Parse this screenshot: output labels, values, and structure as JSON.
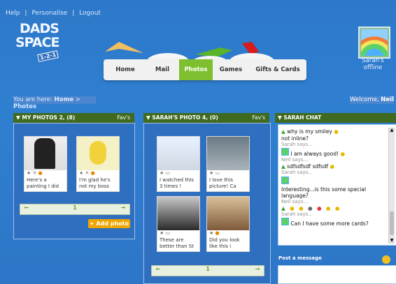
{
  "topbar": {
    "help": "Help",
    "sep1": "|",
    "personalise": "Personalise",
    "sep2": "|",
    "logout": "Logout"
  },
  "brand": {
    "line1": "DADS",
    "line2": "SPACE",
    "tag": "1-2-1"
  },
  "nav": {
    "tabs": [
      {
        "label": "Home"
      },
      {
        "label": "Mail"
      },
      {
        "label": "Photos"
      },
      {
        "label": "Games"
      },
      {
        "label": "Gifts & Cards"
      }
    ]
  },
  "profile": {
    "name": "Sarah's",
    "status": "offline"
  },
  "breadcrumb": {
    "prefix": "You are here:",
    "home": "Home",
    "sep": ">",
    "current": "Photos"
  },
  "welcome": {
    "text": "Welcome,",
    "user": "Neil"
  },
  "panels": {
    "my_photos": {
      "title": "MY PHOTOS 2, (8)",
      "fav": "Fav's",
      "cards": [
        {
          "caption": "Here's a painting I did"
        },
        {
          "caption": "I'm glad he's not my boss"
        }
      ],
      "page": "1",
      "add": "Add photo"
    },
    "sarah_photos": {
      "title": "SARAH'S PHOTO 4, (0)",
      "fav": "Fav's",
      "cards": [
        {
          "caption": "I watched this 3 times !"
        },
        {
          "caption": "I love this picture! Ca"
        },
        {
          "caption": "These are better than St"
        },
        {
          "caption": "Did you look like this i"
        }
      ],
      "page": "1"
    },
    "chat": {
      "title": "SARAH CHAT",
      "messages": [
        {
          "text": "why is my smiley"
        },
        {
          "text": "not inline?",
          "says": "Sarah says..."
        },
        {
          "text": "I am always good!",
          "says": "Neil says..."
        },
        {
          "text": "sdfsdfsdf sdfsdf",
          "says": "Sarah says..."
        },
        {
          "text": "Interesting...is this some special language?",
          "says": "Neil says..."
        },
        {
          "text": "",
          "says": "Sarah says..."
        },
        {
          "text": "Can I have some more cards?",
          "says": ""
        }
      ],
      "post_label": "Post a message"
    }
  },
  "colors": {
    "accent": "#7dbf2f",
    "panel_header": "#3f6a1f",
    "background": "#2f78c8",
    "button": "#f0a500"
  }
}
